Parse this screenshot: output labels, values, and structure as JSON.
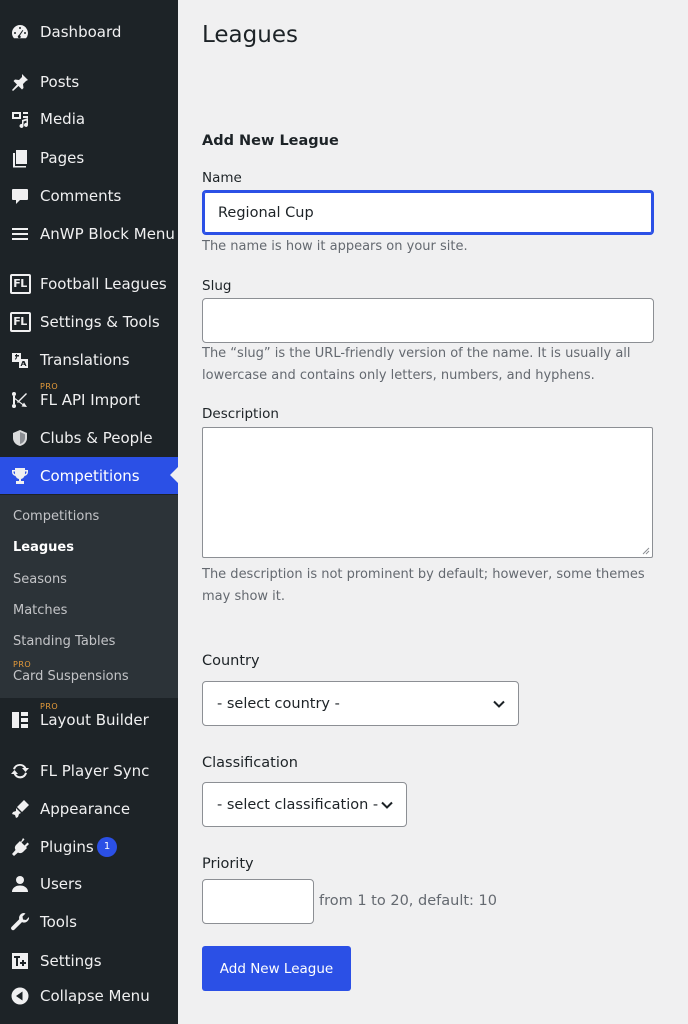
{
  "sidebar": {
    "items": [
      {
        "label": "Dashboard",
        "icon": "dashboard-icon"
      },
      {
        "label": "Posts",
        "icon": "pin-icon"
      },
      {
        "label": "Media",
        "icon": "media-icon"
      },
      {
        "label": "Pages",
        "icon": "pages-icon"
      },
      {
        "label": "Comments",
        "icon": "comment-icon"
      },
      {
        "label": "AnWP Block Menu",
        "icon": "menu-icon"
      },
      {
        "label": "Football Leagues",
        "icon": "fl-icon"
      },
      {
        "label": "Settings & Tools",
        "icon": "fl-icon"
      },
      {
        "label": "Translations",
        "icon": "translation-icon"
      },
      {
        "label": "FL API Import",
        "icon": "api-import-icon",
        "tag": "PRO"
      },
      {
        "label": "Clubs & People",
        "icon": "shield-icon"
      },
      {
        "label": "Competitions",
        "icon": "trophy-icon",
        "active": true
      },
      {
        "label": "Layout Builder",
        "icon": "layout-icon",
        "tag": "PRO"
      },
      {
        "label": "FL Player Sync",
        "icon": "sync-icon"
      },
      {
        "label": "Appearance",
        "icon": "brush-icon"
      },
      {
        "label": "Plugins",
        "icon": "plugin-icon",
        "badge": "1"
      },
      {
        "label": "Users",
        "icon": "user-icon"
      },
      {
        "label": "Tools",
        "icon": "wrench-icon"
      },
      {
        "label": "Settings",
        "icon": "settings-icon"
      },
      {
        "label": "Collapse Menu",
        "icon": "collapse-icon"
      }
    ],
    "submenu": [
      {
        "label": "Competitions"
      },
      {
        "label": "Leagues",
        "current": true
      },
      {
        "label": "Seasons"
      },
      {
        "label": "Matches"
      },
      {
        "label": "Standing Tables"
      },
      {
        "label": "Card Suspensions",
        "tag": "PRO"
      }
    ]
  },
  "page": {
    "title": "Leagues",
    "section_title": "Add New League"
  },
  "form": {
    "name_label": "Name",
    "name_value": "Regional Cup",
    "name_help": "The name is how it appears on your site.",
    "slug_label": "Slug",
    "slug_value": "",
    "slug_help": "The “slug” is the URL-friendly version of the name. It is usually all lowercase and contains only letters, numbers, and hyphens.",
    "description_label": "Description",
    "description_help": "The description is not prominent by default; however, some themes may show it.",
    "country_label": "Country",
    "country_selected": "- select country -",
    "classification_label": "Classification",
    "classification_selected": "- select classification -",
    "priority_label": "Priority",
    "priority_hint": "from 1 to 20, default: 10",
    "submit_label": "Add New League"
  },
  "colors": {
    "sidebar_bg": "#1d2327",
    "submenu_bg": "#2c3338",
    "accent": "#2b50e6",
    "pro_tag": "#e59b3a",
    "page_bg": "#f0f0f1"
  }
}
